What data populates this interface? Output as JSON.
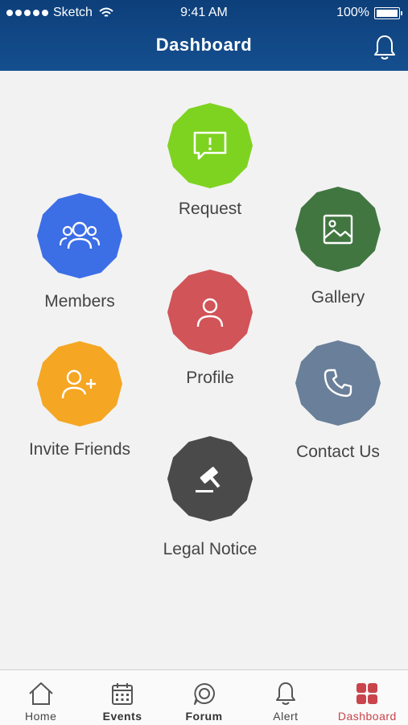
{
  "status_bar": {
    "carrier": "Sketch",
    "time": "9:41 AM",
    "battery": "100%"
  },
  "header": {
    "title": "Dashboard"
  },
  "menu": {
    "request": {
      "label": "Request",
      "color": "#7ed321"
    },
    "members": {
      "label": "Members",
      "color": "#3c6ee6"
    },
    "gallery": {
      "label": "Gallery",
      "color": "#417641"
    },
    "profile": {
      "label": "Profile",
      "color": "#d15458"
    },
    "invite": {
      "label": "Invite Friends",
      "color": "#f5a623"
    },
    "contact": {
      "label": "Contact Us",
      "color": "#6a7f99"
    },
    "legal": {
      "label": "Legal Notice",
      "color": "#4a4a4a"
    }
  },
  "tabs": [
    {
      "label": "Home",
      "icon": "home-icon"
    },
    {
      "label": "Events",
      "icon": "calendar-icon"
    },
    {
      "label": "Forum",
      "icon": "chat-icon"
    },
    {
      "label": "Alert",
      "icon": "bell-icon"
    },
    {
      "label": "Dashboard",
      "icon": "grid-icon",
      "active": true
    }
  ],
  "colors": {
    "header": "#154f8f",
    "active_tab": "#c9444c"
  }
}
